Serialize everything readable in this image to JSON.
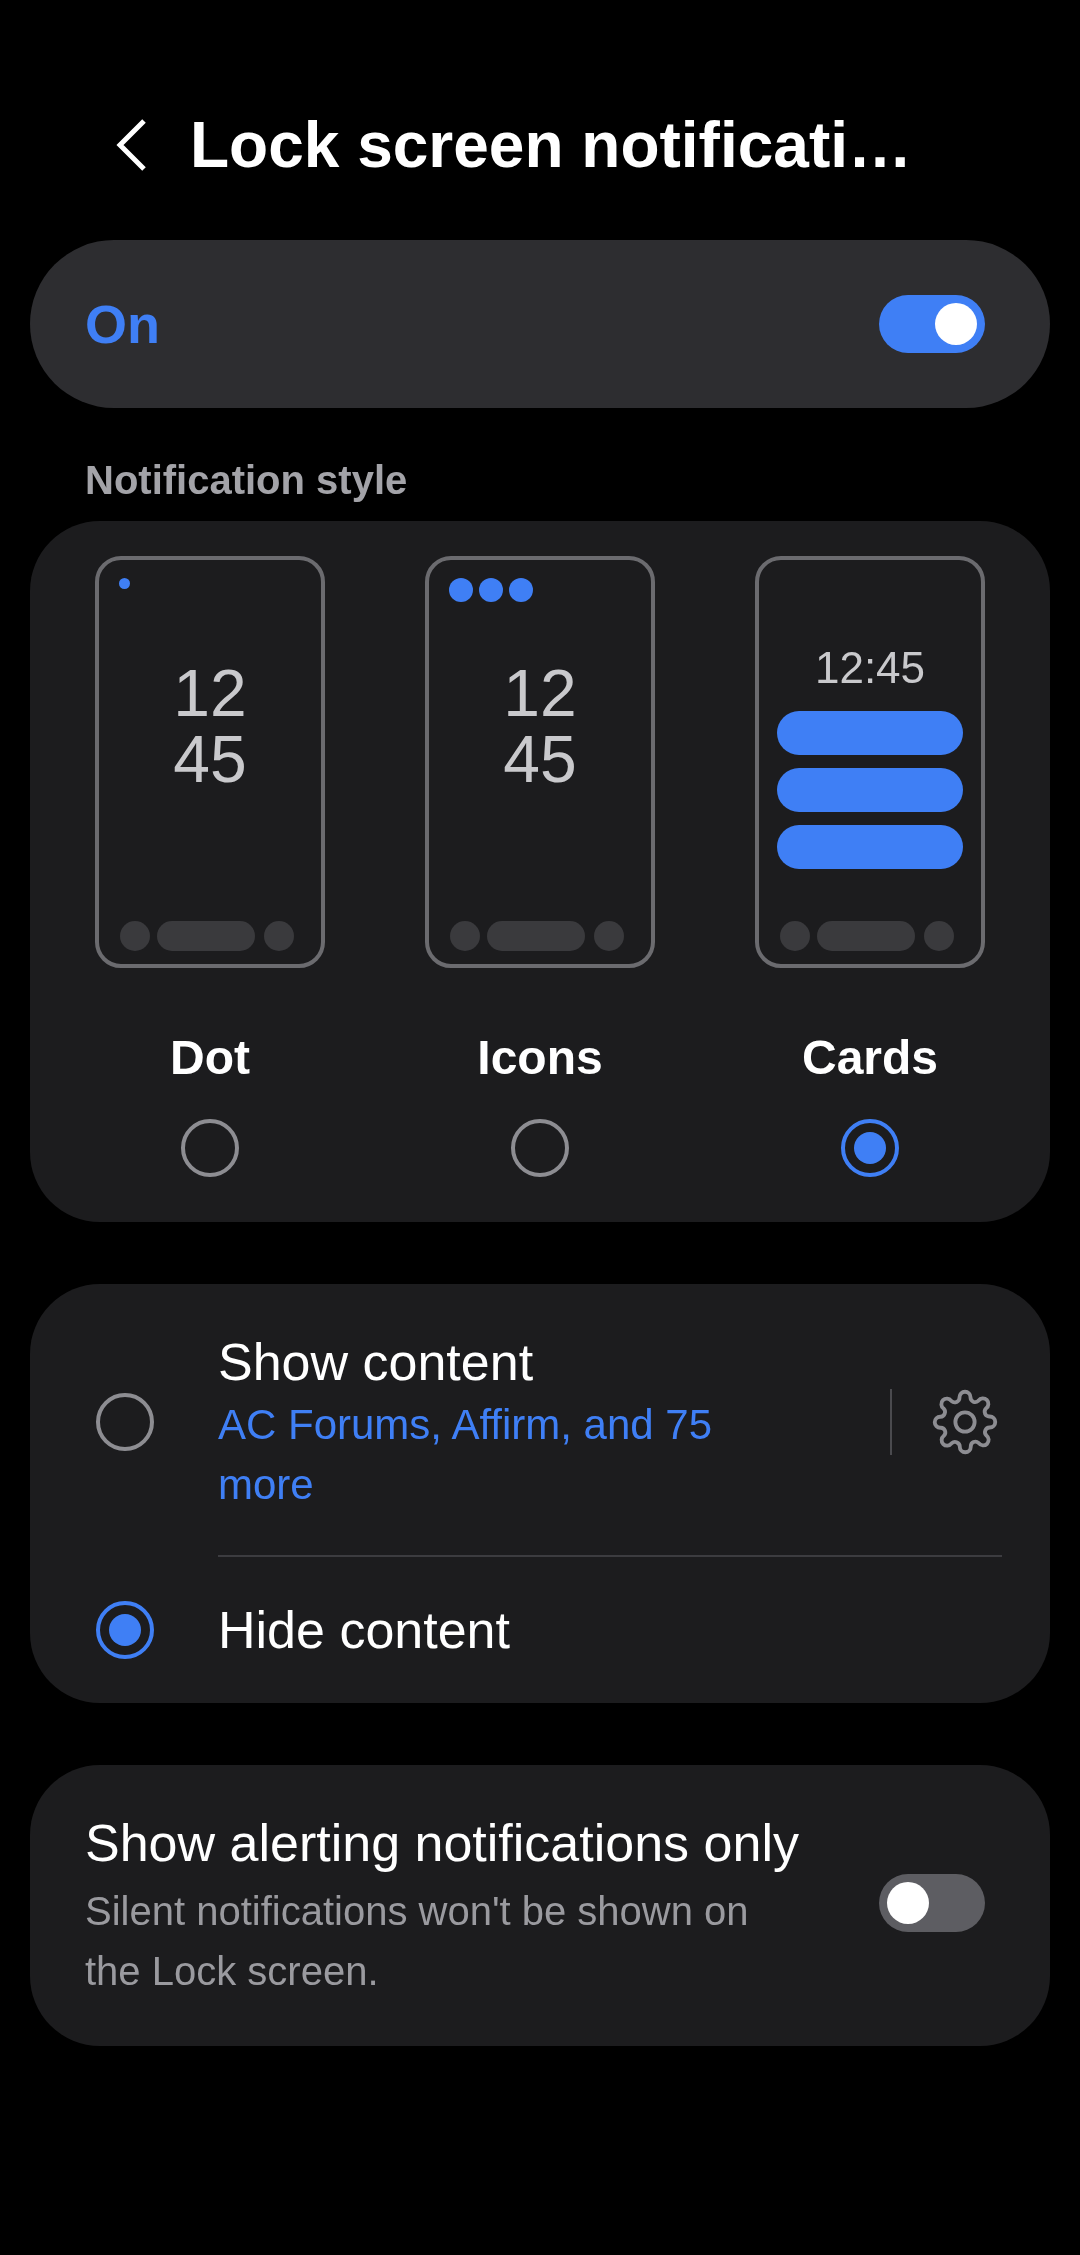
{
  "header": {
    "title": "Lock screen notificati…"
  },
  "master": {
    "label": "On",
    "on": true
  },
  "style_section": {
    "heading": "Notification style",
    "options": [
      {
        "kind": "dot",
        "label": "Dot",
        "selected": false,
        "clock_lines": [
          "12",
          "45"
        ]
      },
      {
        "kind": "icons",
        "label": "Icons",
        "selected": false,
        "clock_lines": [
          "12",
          "45"
        ]
      },
      {
        "kind": "cards",
        "label": "Cards",
        "selected": true,
        "clock_lines": [
          "12:45"
        ]
      }
    ]
  },
  "content_options": [
    {
      "title": "Show content",
      "subtitle": "AC Forums, Affirm, and 75 more",
      "selected": false,
      "has_settings": true
    },
    {
      "title": "Hide content",
      "selected": true
    }
  ],
  "alerting": {
    "title": "Show alerting notifications only",
    "subtitle": "Silent notifications won't be shown on the Lock screen.",
    "on": false
  }
}
